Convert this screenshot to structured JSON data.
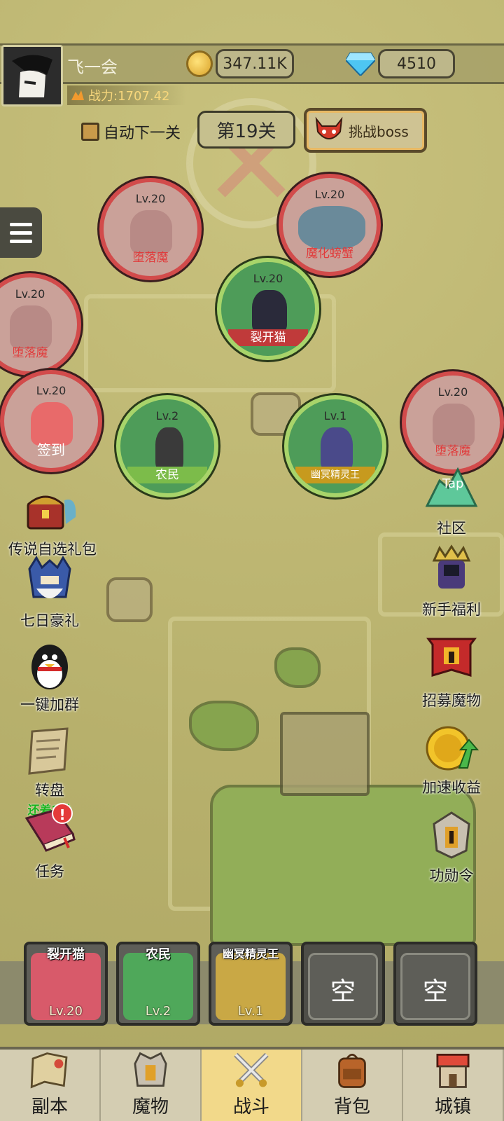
{
  "header": {
    "player_name": "飞一会",
    "power": "战力:1707.42",
    "coins": "347.11K",
    "gems": "4510"
  },
  "stage": {
    "auto_next_label": "自动下一关",
    "stage_label": "第19关",
    "boss_label": "挑战boss"
  },
  "units": [
    {
      "level": "Lv.20",
      "name": "堕落魔",
      "side": "enemy"
    },
    {
      "level": "Lv.20",
      "name": "魔化螃蟹",
      "side": "enemy"
    },
    {
      "level": "Lv.20",
      "name": "裂开猫",
      "side": "ally"
    },
    {
      "level": "Lv.20",
      "name": "堕落魔",
      "side": "enemy"
    },
    {
      "level": "Lv.20",
      "name": "签到",
      "side": "enemy"
    },
    {
      "level": "Lv.2",
      "name": "农民",
      "side": "ally"
    },
    {
      "level": "Lv.1",
      "name": "幽冥精灵王",
      "side": "ally"
    },
    {
      "level": "Lv.20",
      "name": "堕落魔",
      "side": "enemy"
    }
  ],
  "left_buttons": [
    {
      "label": "传说自选礼包",
      "icon": "treasure-chest-icon"
    },
    {
      "label": "七日豪礼",
      "icon": "knight-helmet-icon"
    },
    {
      "label": "一键加群",
      "icon": "penguin-icon"
    },
    {
      "label": "转盘",
      "sub": "还差2关",
      "icon": "scroll-icon"
    },
    {
      "label": "任务",
      "icon": "book-icon",
      "badge": "!"
    }
  ],
  "right_buttons": [
    {
      "label": "社区",
      "icon": "tap-icon",
      "icon_text": "Tap"
    },
    {
      "label": "新手福利",
      "icon": "king-icon"
    },
    {
      "label": "招募魔物",
      "icon": "banner-helmet-icon"
    },
    {
      "label": "加速收益",
      "icon": "coin-arrow-icon"
    },
    {
      "label": "功勋令",
      "icon": "medal-helmet-icon"
    }
  ],
  "team_slots": [
    {
      "name": "裂开猫",
      "level": "Lv.20",
      "color": "#d85a6a"
    },
    {
      "name": "农民",
      "level": "Lv.2",
      "color": "#4fa85a"
    },
    {
      "name": "幽冥精灵王",
      "level": "Lv.1",
      "color": "#c9a845"
    },
    {
      "empty_label": "空"
    },
    {
      "empty_label": "空"
    }
  ],
  "nav": [
    {
      "label": "副本",
      "icon": "map-icon"
    },
    {
      "label": "魔物",
      "icon": "helmet-icon"
    },
    {
      "label": "战斗",
      "icon": "crossed-swords-icon",
      "active": true
    },
    {
      "label": "背包",
      "icon": "backpack-icon"
    },
    {
      "label": "城镇",
      "icon": "shop-icon"
    }
  ]
}
